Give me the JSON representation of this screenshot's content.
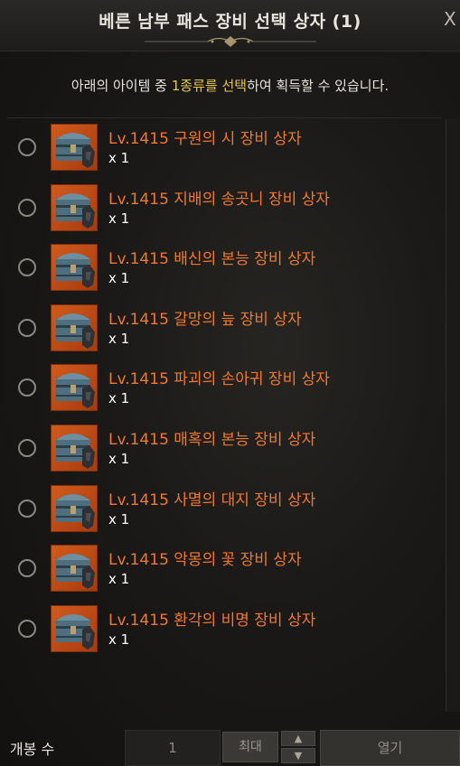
{
  "header": {
    "title": "베른 남부 패스 장비 선택 상자 (1)",
    "close_label": "X"
  },
  "subtitle": {
    "prefix": "아래의 아이템 중 ",
    "highlight": "1종류를 선택",
    "suffix": "하여 획득할 수 있습니다."
  },
  "items": [
    {
      "name": "Lv.1415 구원의 시 장비 상자",
      "qty": "x 1"
    },
    {
      "name": "Lv.1415 지배의 송곳니 장비 상자",
      "qty": "x 1"
    },
    {
      "name": "Lv.1415 배신의 본능 장비 상자",
      "qty": "x 1"
    },
    {
      "name": "Lv.1415 갈망의 늪 장비 상자",
      "qty": "x 1"
    },
    {
      "name": "Lv.1415 파괴의 손아귀 장비 상자",
      "qty": "x 1"
    },
    {
      "name": "Lv.1415 매혹의 본능 장비 상자",
      "qty": "x 1"
    },
    {
      "name": "Lv.1415 사멸의 대지 장비 상자",
      "qty": "x 1"
    },
    {
      "name": "Lv.1415 악몽의 꽃 장비 상자",
      "qty": "x 1"
    },
    {
      "name": "Lv.1415 환각의 비명 장비 상자",
      "qty": "x 1"
    }
  ],
  "item_icon": "treasure-chest-icon",
  "footer": {
    "open_count_label": "개봉 수",
    "quantity_value": "1",
    "max_label": "최대",
    "up_icon": "chevron-up-icon",
    "down_icon": "chevron-down-icon",
    "open_label": "열기"
  },
  "colors": {
    "item_name": "#f07830",
    "highlight": "#e8c84a",
    "icon_bg": "#d25a1c"
  }
}
